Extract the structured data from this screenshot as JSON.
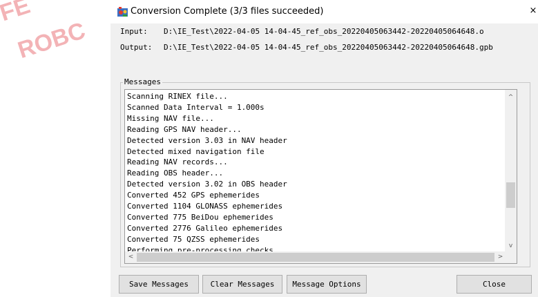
{
  "watermark": {
    "line1": "FE",
    "line2": "ROBC"
  },
  "window": {
    "title": "Conversion Complete (3/3 files succeeded)",
    "close_glyph": "×",
    "icon": "gnss-app-icon"
  },
  "paths": {
    "input_label": "Input:",
    "input_value": "D:\\IE_Test\\2022-04-05 14-04-45_ref_obs_20220405063442-20220405064648.o",
    "output_label": "Output:",
    "output_value": "D:\\IE_Test\\2022-04-05 14-04-45_ref_obs_20220405063442-20220405064648.gpb"
  },
  "messages": {
    "group_label": "Messages",
    "lines": [
      "Scanning RINEX file...",
      "Scanned Data Interval = 1.000s",
      "Missing NAV file...",
      "Reading GPS NAV header...",
      "Detected version 3.03 in NAV header",
      "Detected mixed navigation file",
      "Reading NAV records...",
      "Reading OBS header...",
      "Detected version 3.02 in OBS header",
      "Converted 452 GPS ephemerides",
      "Converted 1104 GLONASS ephemerides",
      "Converted 775 BeiDou ephemerides",
      "Converted 2776 Galileo ephemerides",
      "Converted 75 QZSS ephemerides",
      "Performing pre-processing checks..."
    ],
    "scroll_up": "^",
    "scroll_down": "v",
    "scroll_left": "<",
    "scroll_right": ">"
  },
  "buttons": {
    "save": "Save Messages",
    "clear": "Clear Messages",
    "options": "Message Options",
    "close": "Close"
  },
  "colors": {
    "window_bg": "#f0f0f0",
    "watermark": "#e8202a"
  }
}
